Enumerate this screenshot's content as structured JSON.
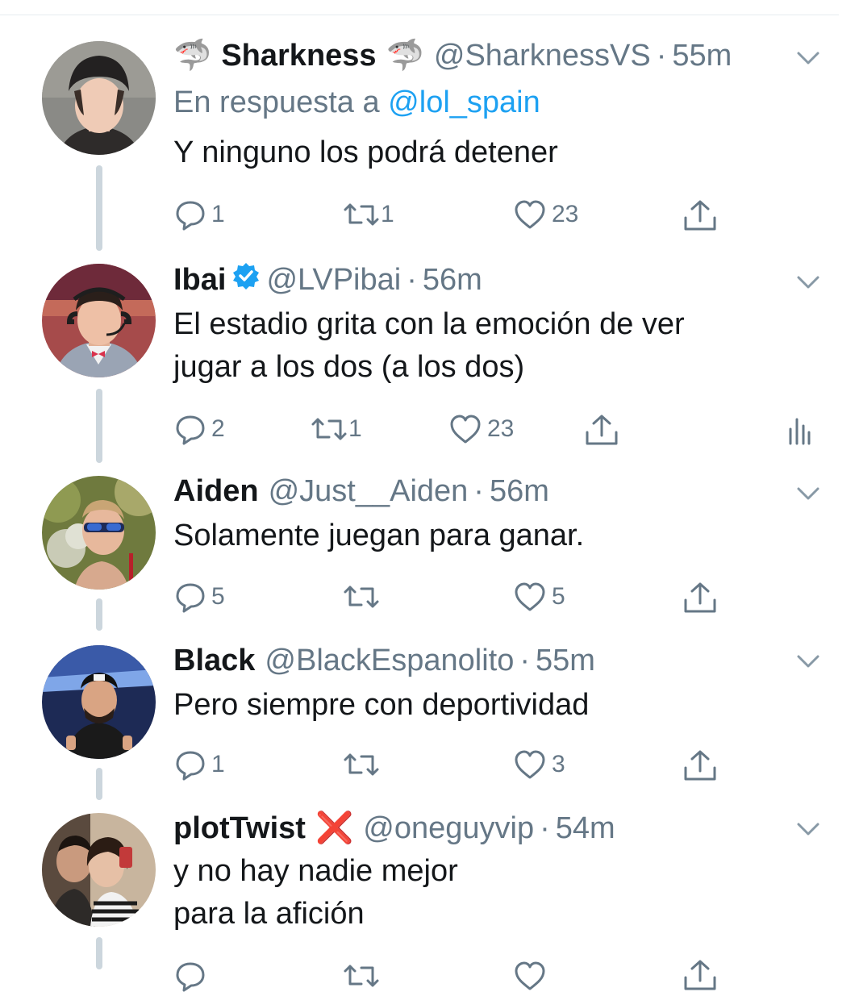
{
  "tweets": [
    {
      "name": "Sharkness",
      "name_emoji_left": "🦈",
      "name_emoji_right": "🦈",
      "handle": "@SharknessVS",
      "time": "55m",
      "reply_prefix": "En respuesta a",
      "reply_mention": "@lol_spain",
      "text": "Y ninguno los podrá detener",
      "replies": "1",
      "retweets": "1",
      "likes": "23"
    },
    {
      "name": "Ibai",
      "verified": true,
      "handle": "@LVPibai",
      "time": "56m",
      "text_line1": "El estadio grita con la emoción de ver",
      "text_line2": "jugar a los dos (a los dos)",
      "replies": "2",
      "retweets": "1",
      "likes": "23"
    },
    {
      "name": "Aiden",
      "handle": "@Just__Aiden",
      "time": "56m",
      "text": "Solamente juegan para ganar.",
      "replies": "5",
      "retweets": "",
      "likes": "5"
    },
    {
      "name": "Black",
      "handle": "@BlackEspanolito",
      "time": "55m",
      "text": "Pero siempre con deportividad",
      "replies": "1",
      "retweets": "",
      "likes": "3"
    },
    {
      "name": "plotTwist",
      "name_emoji_right": "❌",
      "handle": "@oneguyvip",
      "time": "54m",
      "text_line1": "y no hay nadie mejor",
      "text_line2": "para la afición"
    }
  ],
  "separator": "·",
  "colors": {
    "text": "#14171a",
    "secondary": "#657786",
    "link": "#1da1f2",
    "thread_line": "#ccd6dd",
    "verified": "#1da1f2"
  }
}
